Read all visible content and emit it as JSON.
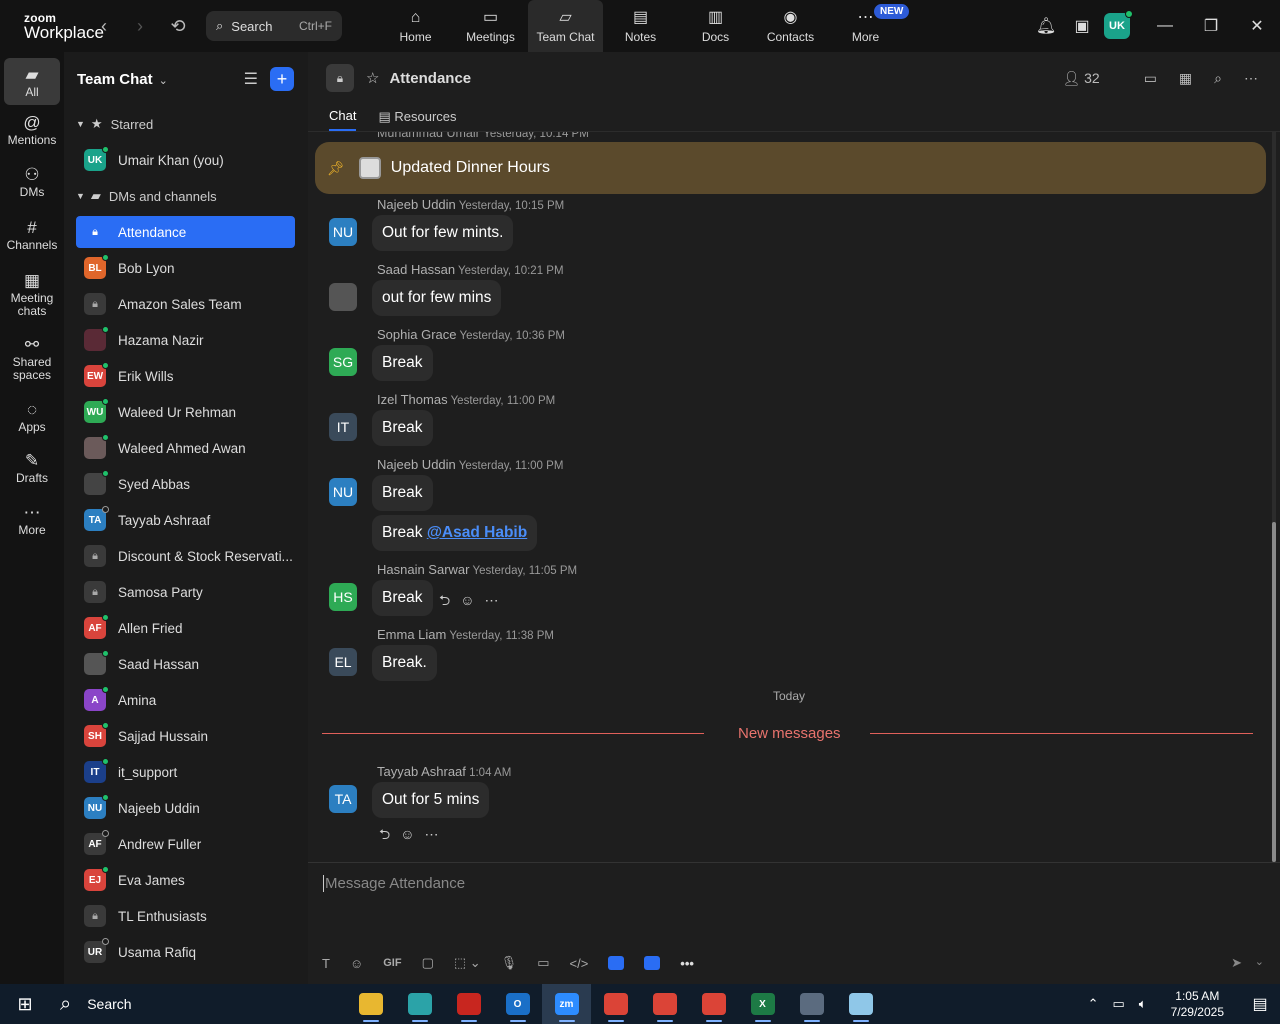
{
  "topbar": {
    "brand_top": "zoom",
    "brand_bottom": "Workplace",
    "search_label": "Search",
    "search_shortcut": "Ctrl+F",
    "nav": [
      {
        "label": "Home",
        "icon": "home-icon"
      },
      {
        "label": "Meetings",
        "icon": "video-icon"
      },
      {
        "label": "Team Chat",
        "icon": "chat-icon",
        "active": true
      },
      {
        "label": "Notes",
        "icon": "notes-icon"
      },
      {
        "label": "Docs",
        "icon": "docs-icon"
      },
      {
        "label": "Contacts",
        "icon": "contacts-icon"
      },
      {
        "label": "More",
        "icon": "more-icon",
        "badge": "NEW"
      }
    ],
    "user_initials": "UK"
  },
  "rail": [
    {
      "label": "All",
      "icon": "chat-bubble-icon",
      "active": true
    },
    {
      "label": "Mentions",
      "icon": "at-icon"
    },
    {
      "label": "DMs",
      "icon": "people-icon"
    },
    {
      "label": "Channels",
      "icon": "hash-icon"
    },
    {
      "label": "Meeting chats",
      "icon": "calendar-icon"
    },
    {
      "label": "Shared spaces",
      "icon": "share-icon"
    },
    {
      "label": "Apps",
      "icon": "apps-icon"
    },
    {
      "label": "Drafts",
      "icon": "drafts-icon"
    },
    {
      "label": "More",
      "icon": "ellipsis-icon"
    }
  ],
  "sidebar": {
    "title": "Team Chat",
    "starred_label": "Starred",
    "starred": [
      {
        "name": "Umair Khan (you)",
        "initials": "UK",
        "color": "#1aa38a",
        "status": "online"
      }
    ],
    "dms_label": "DMs and channels",
    "items": [
      {
        "name": "Attendance",
        "type": "channel",
        "selected": true
      },
      {
        "name": "Bob Lyon",
        "initials": "BL",
        "color": "#e0662b",
        "status": "online"
      },
      {
        "name": "Amazon Sales Team",
        "type": "channel"
      },
      {
        "name": "Hazama Nazir",
        "initials": "",
        "color": "#5a2a36",
        "status": "online-outline"
      },
      {
        "name": "Erik Wills",
        "initials": "EW",
        "color": "#d9443c",
        "status": "online"
      },
      {
        "name": "Waleed Ur Rehman",
        "initials": "WU",
        "color": "#2eaa55",
        "status": "online"
      },
      {
        "name": "Waleed Ahmed Awan",
        "initials": "",
        "color": "#6b5a5a",
        "status": "online"
      },
      {
        "name": "Syed Abbas",
        "initials": "",
        "color": "#444444",
        "status": "online"
      },
      {
        "name": "Tayyab Ashraaf",
        "initials": "TA",
        "color": "#2c7fc1",
        "status": "offline"
      },
      {
        "name": "Discount & Stock Reservati...",
        "type": "channel"
      },
      {
        "name": "Samosa Party",
        "type": "channel"
      },
      {
        "name": "Allen Fried",
        "initials": "AF",
        "color": "#d9443c",
        "status": "online"
      },
      {
        "name": "Saad Hassan",
        "initials": "",
        "color": "#555555",
        "status": "online"
      },
      {
        "name": "Amina",
        "initials": "A",
        "color": "#8a45c8",
        "status": "online"
      },
      {
        "name": "Sajjad Hussain",
        "initials": "SH",
        "color": "#d9443c",
        "status": "online"
      },
      {
        "name": "it_support",
        "initials": "IT",
        "color": "#1b3f8a",
        "status": "online-outline"
      },
      {
        "name": "Najeeb Uddin",
        "initials": "NU",
        "color": "#2c7fc1",
        "status": "online"
      },
      {
        "name": "Andrew Fuller",
        "initials": "AF",
        "color": "#3a3a3a",
        "status": "offline"
      },
      {
        "name": "Eva James",
        "initials": "EJ",
        "color": "#d9443c",
        "status": "online"
      },
      {
        "name": "TL Enthusiasts",
        "type": "channel"
      },
      {
        "name": "Usama Rafiq",
        "initials": "UR",
        "color": "#3a3a3a",
        "status": "offline"
      }
    ]
  },
  "chat": {
    "title": "Attendance",
    "member_count": "32",
    "tabs": [
      {
        "label": "Chat",
        "active": true
      },
      {
        "label": "Resources"
      }
    ],
    "cut_name": "Muhammad Umair",
    "cut_time": "Yesterday, 10:14 PM",
    "pinned": "Updated Dinner Hours",
    "messages": [
      {
        "sender": "Najeeb Uddin",
        "time": "Yesterday, 10:15 PM",
        "initials": "NU",
        "color": "#2c7fc1",
        "texts": [
          "Out for few mints."
        ]
      },
      {
        "sender": "Saad Hassan",
        "time": "Yesterday, 10:21 PM",
        "initials": "",
        "color": "#555555",
        "texts": [
          "out for few mins"
        ]
      },
      {
        "sender": "Sophia Grace",
        "time": "Yesterday, 10:36 PM",
        "initials": "SG",
        "color": "#2eaa55",
        "texts": [
          "Break"
        ]
      },
      {
        "sender": "Izel Thomas",
        "time": "Yesterday, 11:00 PM",
        "initials": "IT",
        "color": "#3a4a5a",
        "texts": [
          "Break"
        ]
      },
      {
        "sender": "Najeeb Uddin",
        "time": "Yesterday, 11:00 PM",
        "initials": "NU",
        "color": "#2c7fc1",
        "texts": [
          "Break"
        ],
        "extra": {
          "text": "Break",
          "mention": "@Asad Habib"
        }
      },
      {
        "sender": "Hasnain Sarwar",
        "time": "Yesterday, 11:05 PM",
        "initials": "HS",
        "color": "#2eaa55",
        "texts": [
          "Break"
        ],
        "hover_actions": true
      },
      {
        "sender": "Emma Liam",
        "time": "Yesterday, 11:38 PM",
        "initials": "EL",
        "color": "#3a4a5a",
        "texts": [
          "Break."
        ]
      }
    ],
    "today_label": "Today",
    "new_messages_label": "New messages",
    "latest": {
      "sender": "Tayyab Ashraaf",
      "time": "1:04 AM",
      "initials": "TA",
      "color": "#2c7fc1",
      "text": "Out for 5 mins"
    },
    "compose_placeholder": "Message Attendance"
  },
  "taskbar": {
    "search_label": "Search",
    "time": "1:05 AM",
    "date": "7/29/2025",
    "apps": [
      {
        "name": "file-explorer-icon",
        "color": "#e8b730",
        "label": ""
      },
      {
        "name": "app-icon",
        "color": "#2ba3a8",
        "label": ""
      },
      {
        "name": "filezilla-icon",
        "color": "#c8261f",
        "label": ""
      },
      {
        "name": "outlook-icon",
        "color": "#1a6fc7",
        "label": "O"
      },
      {
        "name": "zoom-icon",
        "color": "#2d8cff",
        "label": "zm",
        "active": true
      },
      {
        "name": "chrome-icon",
        "color": "#db4437",
        "label": ""
      },
      {
        "name": "chrome-icon-2",
        "color": "#db4437",
        "label": ""
      },
      {
        "name": "chrome-icon-3",
        "color": "#db4437",
        "label": ""
      },
      {
        "name": "excel-icon",
        "color": "#1d7a45",
        "label": "X"
      },
      {
        "name": "calculator-icon",
        "color": "#5b6b7f",
        "label": ""
      },
      {
        "name": "notepad-icon",
        "color": "#8fc7e8",
        "label": ""
      }
    ]
  }
}
